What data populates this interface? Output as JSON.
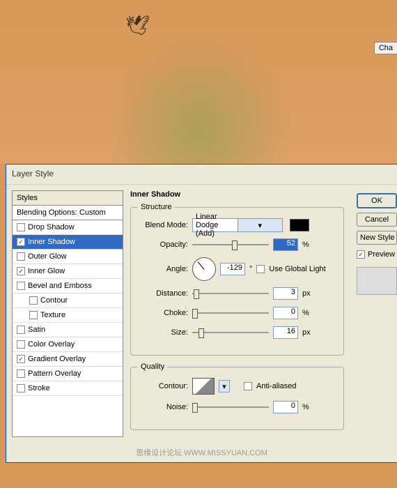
{
  "canvas": {
    "cha_label": "Cha"
  },
  "dialog": {
    "title": "Layer Style",
    "styles_header": "Styles",
    "blend_opts": "Blending Options: Custom",
    "items": [
      {
        "label": "Drop Shadow",
        "checked": false,
        "indent": false
      },
      {
        "label": "Inner Shadow",
        "checked": true,
        "indent": false,
        "selected": true
      },
      {
        "label": "Outer Glow",
        "checked": false,
        "indent": false
      },
      {
        "label": "Inner Glow",
        "checked": true,
        "indent": false
      },
      {
        "label": "Bevel and Emboss",
        "checked": false,
        "indent": false
      },
      {
        "label": "Contour",
        "checked": false,
        "indent": true
      },
      {
        "label": "Texture",
        "checked": false,
        "indent": true
      },
      {
        "label": "Satin",
        "checked": false,
        "indent": false
      },
      {
        "label": "Color Overlay",
        "checked": false,
        "indent": false
      },
      {
        "label": "Gradient Overlay",
        "checked": true,
        "indent": false
      },
      {
        "label": "Pattern Overlay",
        "checked": false,
        "indent": false
      },
      {
        "label": "Stroke",
        "checked": false,
        "indent": false
      }
    ],
    "panel_title": "Inner Shadow",
    "structure": {
      "legend": "Structure",
      "blend_mode_label": "Blend Mode:",
      "blend_mode_value": "Linear Dodge (Add)",
      "opacity_label": "Opacity:",
      "opacity_value": "52",
      "opacity_unit": "%",
      "angle_label": "Angle:",
      "angle_value": "-129",
      "angle_unit": "°",
      "global_light_label": "Use Global Light",
      "distance_label": "Distance:",
      "distance_value": "3",
      "distance_unit": "px",
      "choke_label": "Choke:",
      "choke_value": "0",
      "choke_unit": "%",
      "size_label": "Size:",
      "size_value": "16",
      "size_unit": "px"
    },
    "quality": {
      "legend": "Quality",
      "contour_label": "Contour:",
      "antialiased_label": "Anti-aliased",
      "noise_label": "Noise:",
      "noise_value": "0",
      "noise_unit": "%"
    },
    "buttons": {
      "ok": "OK",
      "cancel": "Cancel",
      "new_style": "New Style",
      "preview": "Preview"
    }
  },
  "footer": {
    "text": "思缘设计论坛  WWW.MISSYUAN.COM"
  }
}
